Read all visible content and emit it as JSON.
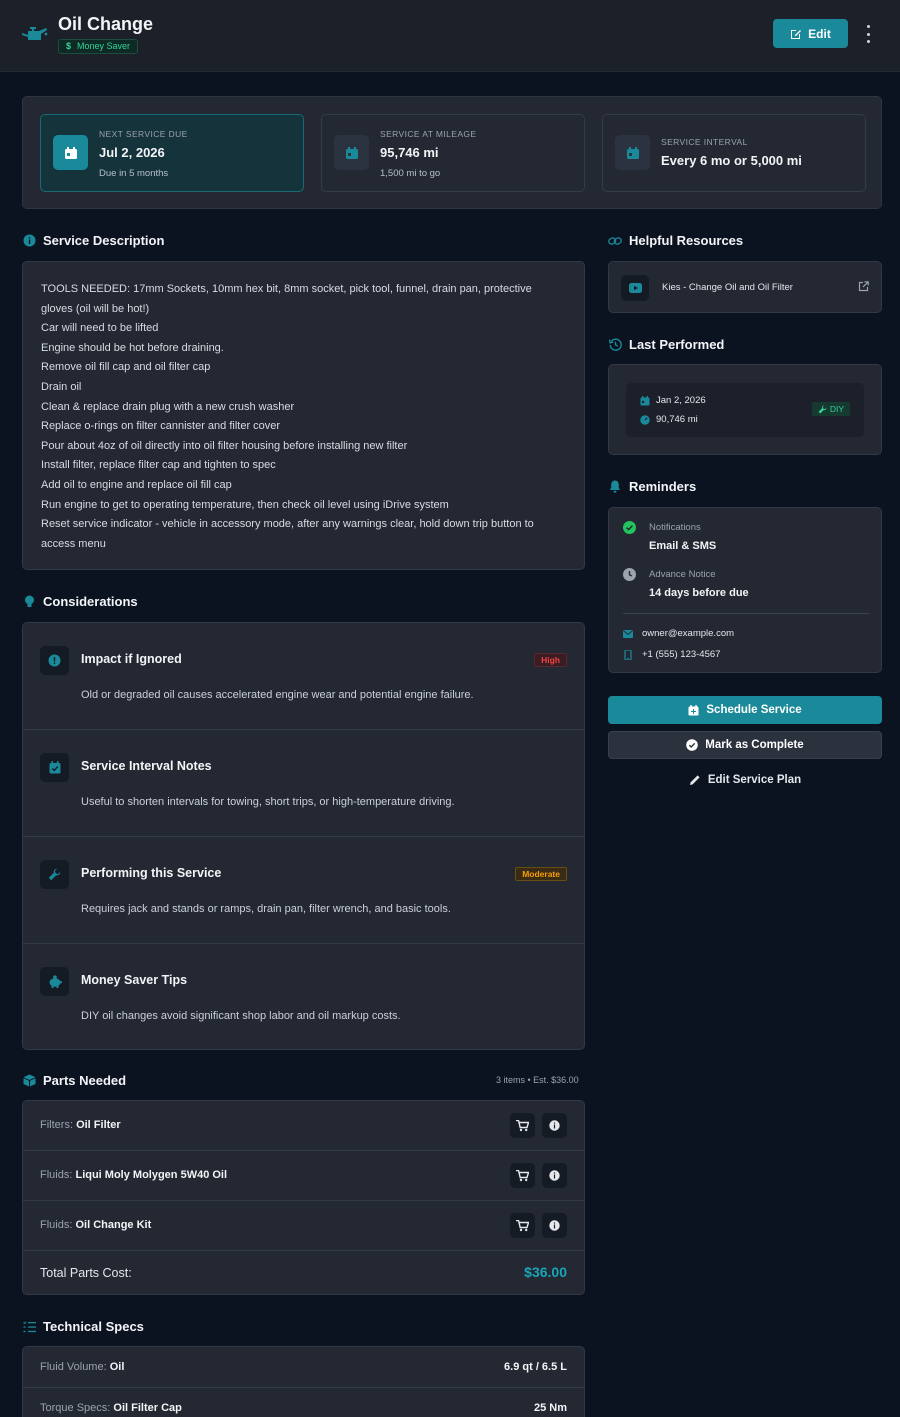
{
  "header": {
    "title": "Oil Change",
    "badge": {
      "symbol": "$",
      "label": "Money Saver"
    },
    "edit_label": "Edit"
  },
  "summary": [
    {
      "label": "NEXT SERVICE DUE",
      "value": "Jul 2, 2026",
      "sub": "Due in 5 months",
      "active": true
    },
    {
      "label": "SERVICE AT MILEAGE",
      "value": "95,746 mi",
      "sub": "1,500 mi to go",
      "active": false
    },
    {
      "label": "SERVICE INTERVAL",
      "value": "Every 6 mo or 5,000 mi",
      "sub": "",
      "active": false
    }
  ],
  "description": {
    "title": "Service Description",
    "lines": [
      "TOOLS NEEDED: 17mm Sockets, 10mm hex bit, 8mm socket, pick tool, funnel, drain pan, protective gloves (oil will be hot!)",
      "Car will need to be lifted",
      "Engine should be hot before draining.",
      "Remove oil fill cap and oil filter cap",
      "Drain oil",
      "Clean & replace drain plug with a new crush washer",
      "Replace o-rings on filter cannister and filter cover",
      "Pour about 4oz of oil directly into oil filter housing before installing new filter",
      "Install filter, replace filter cap and tighten to spec",
      "Add oil to engine and replace oil fill cap",
      "Run engine to get to operating temperature, then check oil level using iDrive system",
      "Reset service indicator - vehicle in accessory mode, after any warnings clear, hold down trip button to access menu"
    ]
  },
  "considerations": {
    "title": "Considerations",
    "items": [
      {
        "title": "Impact if Ignored",
        "text": "Old or degraded oil causes accelerated engine wear and potential engine failure.",
        "tag": "High",
        "tag_type": "high",
        "icon": "alert-circle-icon"
      },
      {
        "title": "Service Interval Notes",
        "text": "Useful to shorten intervals for towing, short trips, or high-temperature driving.",
        "tag": "",
        "tag_type": "",
        "icon": "calendar-check-icon"
      },
      {
        "title": "Performing this Service",
        "text": "Requires jack and stands or ramps, drain pan, filter wrench, and basic tools.",
        "tag": "Moderate",
        "tag_type": "mod",
        "icon": "wrench-icon"
      },
      {
        "title": "Money Saver Tips",
        "text": "DIY oil changes avoid significant shop labor and oil markup costs.",
        "tag": "",
        "tag_type": "",
        "icon": "piggy-bank-icon"
      }
    ]
  },
  "parts": {
    "title": "Parts Needed",
    "meta": "3 items • Est. $36.00",
    "items": [
      {
        "category": "Filters:",
        "name": "Oil Filter"
      },
      {
        "category": "Fluids:",
        "name": "Liqui Moly Molygen 5W40 Oil"
      },
      {
        "category": "Fluids:",
        "name": "Oil Change Kit"
      }
    ],
    "total_label": "Total Parts Cost:",
    "total_value": "$36.00"
  },
  "specs": {
    "title": "Technical Specs",
    "items": [
      {
        "category": "Fluid Volume:",
        "name": "Oil",
        "value": "6.9 qt / 6.5 L"
      },
      {
        "category": "Torque Specs:",
        "name": "Oil Filter Cap",
        "value": "25 Nm"
      }
    ]
  },
  "resources": {
    "title": "Helpful Resources",
    "items": [
      {
        "label": "Kies - Change Oil and Oil Filter"
      }
    ]
  },
  "last_performed": {
    "title": "Last Performed",
    "date": "Jan 2, 2026",
    "mileage": "90,746 mi",
    "badge": "DIY"
  },
  "reminders": {
    "title": "Reminders",
    "notifications_label": "Notifications",
    "notifications_value": "Email & SMS",
    "advance_label": "Advance Notice",
    "advance_value": "14 days before due",
    "email": "owner@example.com",
    "phone": "+1 (555) 123-4567"
  },
  "actions": {
    "schedule": "Schedule Service",
    "complete": "Mark as Complete",
    "edit_plan": "Edit Service Plan"
  },
  "colors": {
    "accent": "#1a8a9b",
    "success": "#34d399",
    "danger": "#ef4444",
    "warning": "#f59e0b",
    "bg": "#0b1220",
    "panel": "#232833"
  }
}
